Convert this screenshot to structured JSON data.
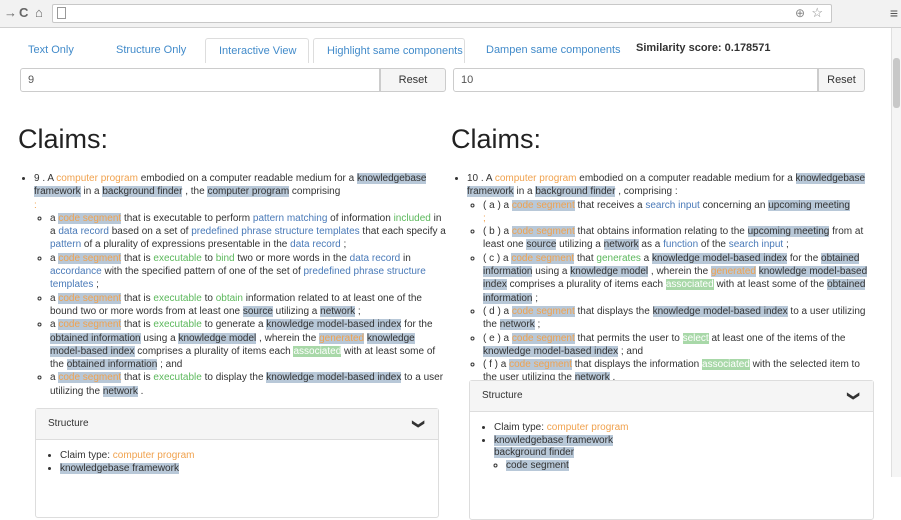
{
  "tabs": [
    "Text Only",
    "Structure Only",
    "Interactive View",
    "Highlight same components",
    "Dampen same components"
  ],
  "similarity": "Similarity score: 0.178571",
  "left": {
    "input_value": "9",
    "reset": "Reset",
    "heading": "Claims:",
    "panel_title": "Structure",
    "panel_claim_type_label": "Claim type: ",
    "panel_claim_type": "computer program",
    "panel_item": "knowledgebase framework"
  },
  "right": {
    "input_value": "10",
    "reset": "Reset",
    "heading": "Claims:",
    "panel_title": "Structure",
    "panel_claim_type_label": "Claim type: ",
    "panel_claim_type": "computer program",
    "panel_item": "knowledgebase framework",
    "panel_item2": "background finder",
    "panel_sub": "code segment"
  },
  "icons": {
    "chevron": "chevron-down-icon",
    "back": "back-arrow-icon",
    "reload": "reload-icon",
    "home": "home-icon",
    "page": "page-icon",
    "zoom": "zoom-icon",
    "star": "star-icon",
    "menu": "menu-icon"
  }
}
